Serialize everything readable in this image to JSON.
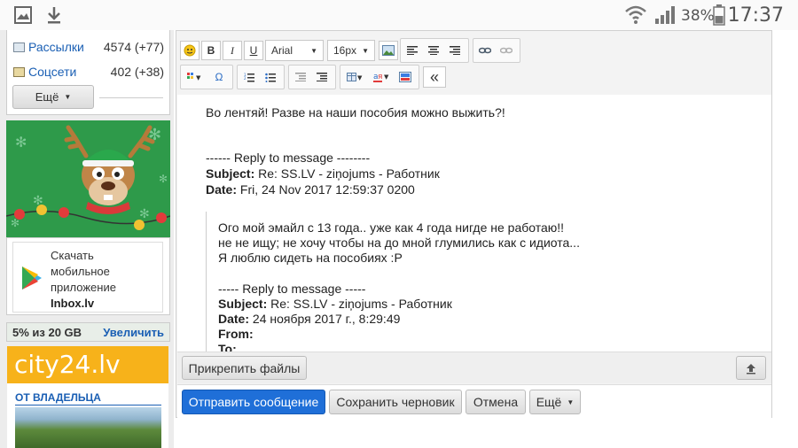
{
  "status_bar": {
    "battery_percent": "38%",
    "time": "17:37",
    "icons": [
      "image-icon",
      "download-icon",
      "wifi-icon",
      "signal-icon",
      "battery-icon"
    ]
  },
  "sidebar": {
    "stats": [
      {
        "name": "Рассылки",
        "value": "4574 (+77)",
        "icon": "newsletter-icon"
      },
      {
        "name": "Соцсети",
        "value": "402 (+38)",
        "icon": "social-icon"
      }
    ],
    "more_label": "Ещё",
    "app_promo": {
      "line1": "Скачать",
      "line2": "мобильное",
      "line3": "приложение",
      "line4": "Inbox.lv"
    },
    "storage": {
      "used": "5% из 20 GB",
      "upgrade_label": "Увеличить"
    },
    "ad": {
      "brand": "city24.lv",
      "label": "ОТ ВЛАДЕЛЬЦА"
    }
  },
  "toolbar": {
    "font_family": "Arial",
    "font_size": "16px",
    "bold": "B",
    "italic": "I",
    "underline": "U",
    "omega": "Ω",
    "collapse": "«"
  },
  "message": {
    "greeting": "Во лентяй! Разве на наши пособия можно выжить?!",
    "reply1": {
      "header": "------ Reply to message --------",
      "subject_label": "Subject:",
      "subject": "Re: SS.LV - ziņojums - Работник",
      "date_label": "Date:",
      "date": "Fri, 24 Nov 2017 12:59:37 0200"
    },
    "quoted": {
      "line1": "Ого мой эмайл с 13 года.. уже как 4 года нигде не работаю!!",
      "line2": "не не ищу; не хочу чтобы на до мной глумились как с идиота...",
      "line3": "Я люблю сидеть на пособиях :P",
      "reply2_header": "----- Reply to message -----",
      "subject_label": "Subject:",
      "subject": "Re: SS.LV - ziņojums - Работник",
      "date_label": "Date:",
      "date": "24 ноября 2017 г., 8:29:49",
      "from_label": "From:",
      "to_label": "To:"
    }
  },
  "attach": {
    "label": "Прикрепить файлы"
  },
  "actions": {
    "send": "Отправить сообщение",
    "draft": "Сохранить черновик",
    "cancel": "Отмена",
    "more": "Ещё"
  },
  "colors": {
    "accent": "#1f6fd8",
    "link": "#1a5fb4",
    "banner_green": "#2e9a4a",
    "city24_orange": "#f7b21a"
  }
}
